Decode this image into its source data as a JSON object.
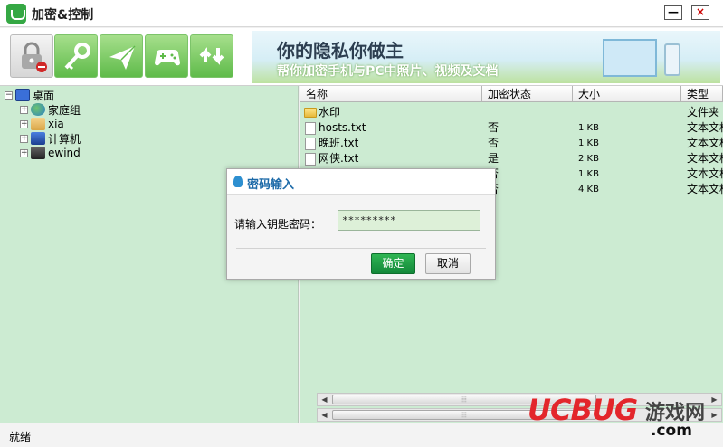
{
  "window": {
    "title": "加密&控制",
    "minimize_label": "—",
    "close_label": "×"
  },
  "toolbar": {
    "buttons": [
      {
        "name": "lock",
        "icon": "lock-icon"
      },
      {
        "name": "key",
        "icon": "key-icon"
      },
      {
        "name": "send",
        "icon": "paper-plane-icon"
      },
      {
        "name": "game",
        "icon": "gamepad-icon"
      },
      {
        "name": "sync",
        "icon": "sync-icon"
      }
    ]
  },
  "banner": {
    "title": "你的隐私你做主",
    "subtitle": "帮你加密手机与PC中照片、视频及文档"
  },
  "tree": {
    "root": {
      "label": "桌面",
      "expander": "−"
    },
    "children": [
      {
        "label": "家庭组",
        "expander": "+"
      },
      {
        "label": "xia",
        "expander": "+"
      },
      {
        "label": "计算机",
        "expander": "+"
      },
      {
        "label": "ewind",
        "expander": "+"
      }
    ]
  },
  "file_list": {
    "columns": [
      "名称",
      "加密状态",
      "大小",
      "类型"
    ],
    "rows": [
      {
        "name": "水印",
        "status": "",
        "size": "",
        "type": "文件夹",
        "kind": "folder"
      },
      {
        "name": "hosts.txt",
        "status": "否",
        "size": "1 KB",
        "type": "文本文档",
        "kind": "file"
      },
      {
        "name": "晚班.txt",
        "status": "否",
        "size": "1 KB",
        "type": "文本文档",
        "kind": "file"
      },
      {
        "name": "网侠.txt",
        "status": "是",
        "size": "2 KB",
        "type": "文本文档",
        "kind": "file"
      },
      {
        "name": "",
        "status": "否",
        "size": "1 KB",
        "type": "文本文档",
        "kind": "file"
      },
      {
        "name": "",
        "status": "否",
        "size": "4 KB",
        "type": "文本文档",
        "kind": "file"
      }
    ],
    "scroll_grip": "⦙⦙⦙"
  },
  "dialog": {
    "title": "密码输入",
    "label": "请输入钥匙密码：",
    "password_value": "*********",
    "ok_label": "确定",
    "cancel_label": "取消"
  },
  "status": {
    "text": "就绪"
  },
  "watermark": {
    "main": "UCBUG",
    "site": "游戏网",
    "domain": ".com"
  }
}
